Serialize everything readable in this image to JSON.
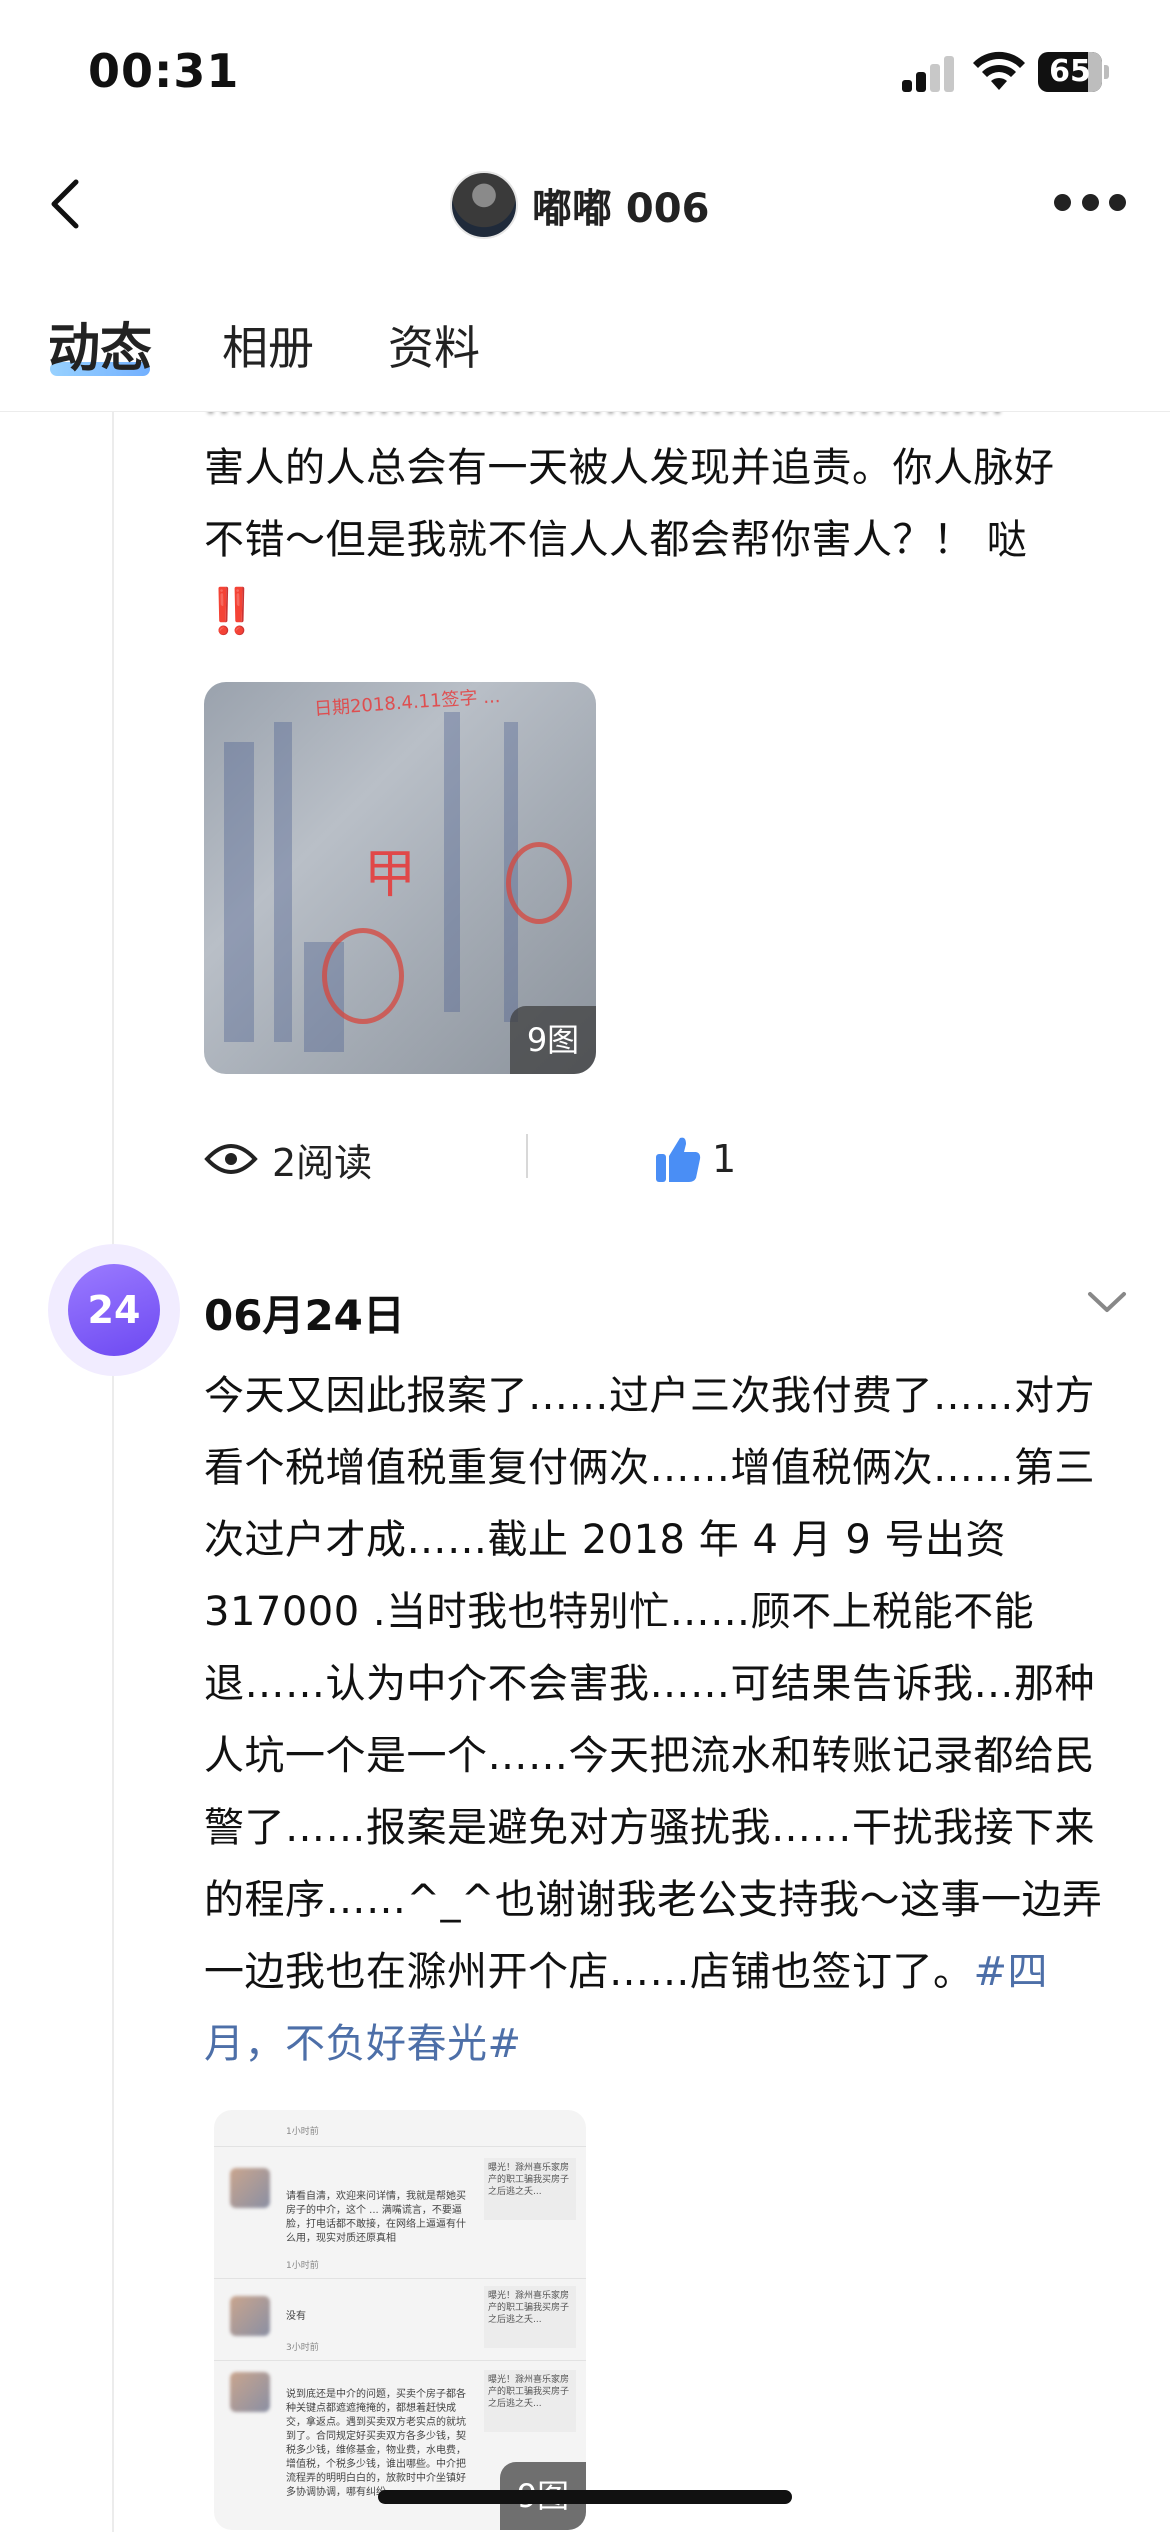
{
  "status_bar": {
    "time": "00:31",
    "battery": "65"
  },
  "header": {
    "title": "嘟嘟 006"
  },
  "tabs": [
    {
      "label": "动态",
      "active": true
    },
    {
      "label": "相册",
      "active": false
    },
    {
      "label": "资料",
      "active": false
    }
  ],
  "post1": {
    "text_line1": "害人的人总会有一天被人发现并追责。你人脉好",
    "text_line2": "不错～但是我就不信人人都会帮你害人？！ 哒",
    "emoji": "‼️",
    "image_count": "9图",
    "image_stamp_char": "甲",
    "image_note": "日期2018.4.11签字 ...",
    "views": "2阅读",
    "likes": "1"
  },
  "post2": {
    "day_badge": "24",
    "date": "06月24日",
    "text": "今天又因此报案了……过户三次我付费了……对方看个税增值税重复付俩次……增值税俩次……第三次过户才成……截止 2018 年 4 月 9 号出资 317000 .当时我也特别忙……顾不上税能不能退……认为中介不会害我……可结果告诉我…那种人坑一个是一个……今天把流水和转账记录都给民警了……报案是避免对方骚扰我……干扰我接下来的程序……^_^也谢谢我老公支持我～这事一边弄一边我也在滁州开个店……店铺也签订了。",
    "hashtag": "#四月，不负好春光#",
    "image_count": "9图",
    "chat": {
      "time1": "1小时前",
      "msg1": "请看自清，欢迎来问详情，我就是帮她买房子的中介，这个 ... 满嘴谎言，不要逼脸，打电话都不敢接，在网络上逼逼有什么用，现实对质还原真相",
      "time2": "1小时前",
      "msg2": "没有",
      "time3": "3小时前",
      "msg3": "说到底还是中介的问题，买卖个房子都各种关键点都遮遮掩掩的，都想着赶快成交，拿返点。遇到买卖双方老实点的就坑到了。合同规定好买卖双方各多少钱，契税多少钱，维修基金，物业费，水电费，增值税，个税多少钱，谁出哪些。中介把流程弄的明明白白的，放款时中介坐镇好多协调协调，哪有纠纷。",
      "side1": "曝光！滁州喜乐家房产的职工骗我买房子之后逃之夭...",
      "side2": "曝光！滁州喜乐家房产的职工骗我买房子之后逃之夭...",
      "side3": "曝光！滁州喜乐家房产的职工骗我买房子之后逃之夭..."
    }
  }
}
